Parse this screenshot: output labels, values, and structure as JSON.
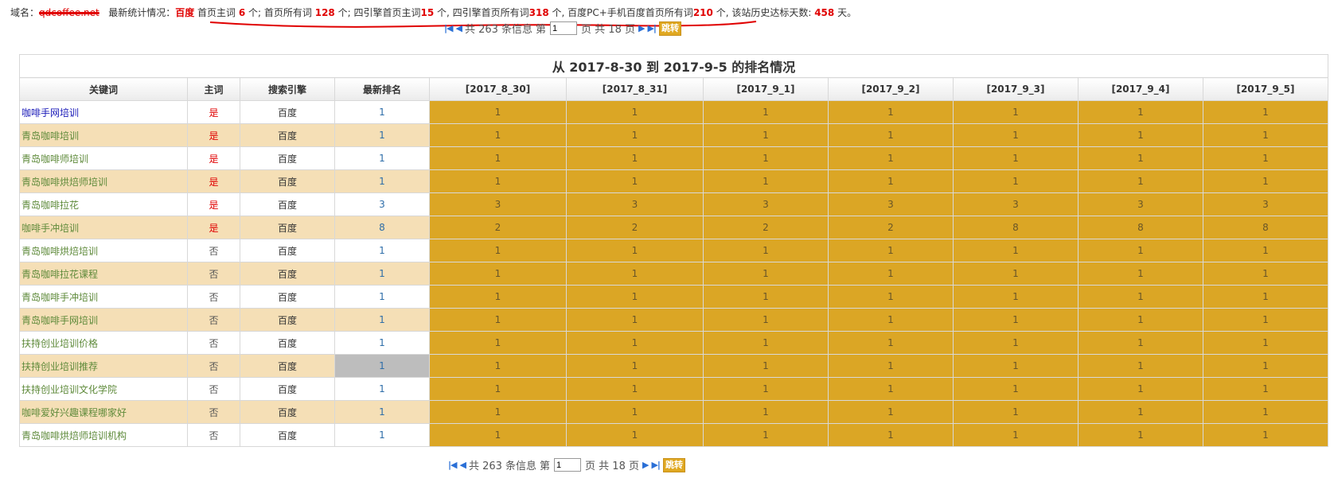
{
  "stats": {
    "domain_label": "域名：",
    "domain_value": "qdcoffee.net",
    "latest_label": "最新统计情况：",
    "seg1": "百度",
    "seg2": " 首页主词 ",
    "v_main_home": "6",
    "seg3": " 个; 首页所有词 ",
    "v_all_home": "128",
    "seg4": " 个; 四引擎首页主词",
    "v_four_main": "15",
    "seg5": " 个, 四引擎首页所有词",
    "v_four_all": "318",
    "seg6": " 个, 百度PC+手机百度首页所有词",
    "v_pc_mobile": "210",
    "seg7": " 个, 该站历史达标天数: ",
    "v_days": "458",
    "seg8": " 天。"
  },
  "pager": {
    "total_text": "共 263 条信息",
    "page_prefix": "第",
    "page_value": "1",
    "page_suffix": "页 共 18 页",
    "go_label": "跳转",
    "first": "|◀",
    "prev": "◀",
    "next": "▶",
    "last": "▶|"
  },
  "table": {
    "title": "从 2017-8-30 到 2017-9-5 的排名情况",
    "headers": [
      "关键词",
      "主词",
      "搜索引擎",
      "最新排名",
      "[2017_8_30]",
      "[2017_8_31]",
      "[2017_9_1]",
      "[2017_9_2]",
      "[2017_9_3]",
      "[2017_9_4]",
      "[2017_9_5]"
    ],
    "rows": [
      {
        "kw": "咖啡手网培训",
        "main": "是",
        "engine": "百度",
        "latest": "1",
        "days": [
          "1",
          "1",
          "1",
          "1",
          "1",
          "1",
          "1"
        ]
      },
      {
        "kw": "青岛咖啡培训",
        "main": "是",
        "engine": "百度",
        "latest": "1",
        "days": [
          "1",
          "1",
          "1",
          "1",
          "1",
          "1",
          "1"
        ]
      },
      {
        "kw": "青岛咖啡师培训",
        "main": "是",
        "engine": "百度",
        "latest": "1",
        "days": [
          "1",
          "1",
          "1",
          "1",
          "1",
          "1",
          "1"
        ]
      },
      {
        "kw": "青岛咖啡烘焙师培训",
        "main": "是",
        "engine": "百度",
        "latest": "1",
        "days": [
          "1",
          "1",
          "1",
          "1",
          "1",
          "1",
          "1"
        ]
      },
      {
        "kw": "青岛咖啡拉花",
        "main": "是",
        "engine": "百度",
        "latest": "3",
        "days": [
          "3",
          "3",
          "3",
          "3",
          "3",
          "3",
          "3"
        ]
      },
      {
        "kw": "咖啡手冲培训",
        "main": "是",
        "engine": "百度",
        "latest": "8",
        "days": [
          "2",
          "2",
          "2",
          "2",
          "8",
          "8",
          "8"
        ]
      },
      {
        "kw": "青岛咖啡烘焙培训",
        "main": "否",
        "engine": "百度",
        "latest": "1",
        "days": [
          "1",
          "1",
          "1",
          "1",
          "1",
          "1",
          "1"
        ]
      },
      {
        "kw": "青岛咖啡拉花课程",
        "main": "否",
        "engine": "百度",
        "latest": "1",
        "days": [
          "1",
          "1",
          "1",
          "1",
          "1",
          "1",
          "1"
        ]
      },
      {
        "kw": "青岛咖啡手冲培训",
        "main": "否",
        "engine": "百度",
        "latest": "1",
        "days": [
          "1",
          "1",
          "1",
          "1",
          "1",
          "1",
          "1"
        ]
      },
      {
        "kw": "青岛咖啡手网培训",
        "main": "否",
        "engine": "百度",
        "latest": "1",
        "days": [
          "1",
          "1",
          "1",
          "1",
          "1",
          "1",
          "1"
        ]
      },
      {
        "kw": "扶持创业培训价格",
        "main": "否",
        "engine": "百度",
        "latest": "1",
        "days": [
          "1",
          "1",
          "1",
          "1",
          "1",
          "1",
          "1"
        ]
      },
      {
        "kw": "扶持创业培训推荐",
        "main": "否",
        "engine": "百度",
        "latest": "1",
        "days": [
          "1",
          "1",
          "1",
          "1",
          "1",
          "1",
          "1"
        ]
      },
      {
        "kw": "扶持创业培训文化学院",
        "main": "否",
        "engine": "百度",
        "latest": "1",
        "days": [
          "1",
          "1",
          "1",
          "1",
          "1",
          "1",
          "1"
        ]
      },
      {
        "kw": "咖啡爱好兴趣课程哪家好",
        "main": "否",
        "engine": "百度",
        "latest": "1",
        "days": [
          "1",
          "1",
          "1",
          "1",
          "1",
          "1",
          "1"
        ]
      },
      {
        "kw": "青岛咖啡烘焙师培训机构",
        "main": "否",
        "engine": "百度",
        "latest": "1",
        "days": [
          "1",
          "1",
          "1",
          "1",
          "1",
          "1",
          "1"
        ]
      }
    ]
  },
  "colors": {
    "rank_cell": "#dba625",
    "alt_row": "#f5dfb6",
    "highlight_red": "#e00000",
    "first_keyword_link": "#1a1ab8",
    "keyword_link": "#5e8a3a"
  }
}
